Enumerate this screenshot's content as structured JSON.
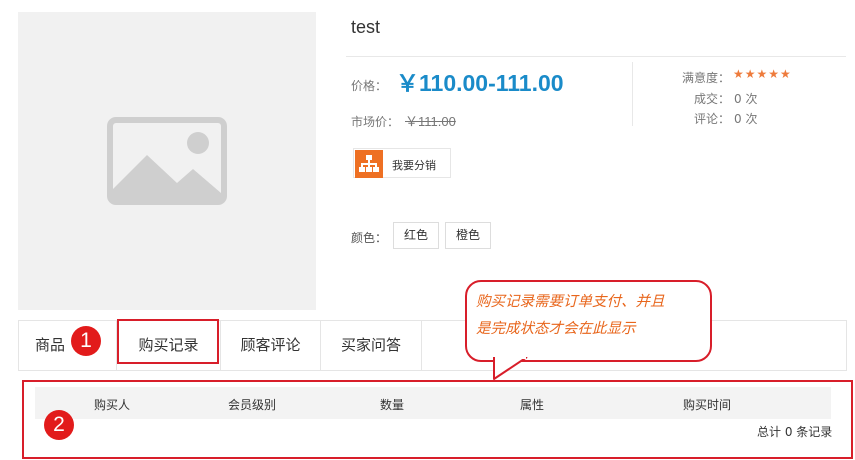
{
  "product": {
    "title": "test",
    "price_label": "价格：",
    "price": "￥110.00-111.00",
    "market_price_label": "市场价：",
    "market_price": "￥111.00",
    "satisfaction_label": "满意度：",
    "stars": "★★★★★",
    "rating": 5,
    "deals_label": "成交：",
    "deals_value": "0 次",
    "reviews_label": "评论：",
    "reviews_value": "0 次",
    "share_label": "我要分销",
    "color_label": "颜色：",
    "color_options": [
      "红色",
      "橙色"
    ]
  },
  "tabs": [
    "商品",
    "购买记录",
    "顾客评论",
    "买家问答"
  ],
  "table": {
    "headers": [
      "购买人",
      "会员级别",
      "数量",
      "属性",
      "购买时间"
    ],
    "total": "总计 0 条记录"
  },
  "annotations": {
    "badge1": "1",
    "badge2": "2",
    "note_line1": "购买记录需要订单支付、并且",
    "note_line2": "是完成状态才会在此显示"
  },
  "colors": {
    "price": "#1a8bc9",
    "star": "#ee7b3c",
    "annotation_red": "#d81e2a",
    "note_orange": "#e8661c",
    "share_icon": "#ee7023"
  }
}
